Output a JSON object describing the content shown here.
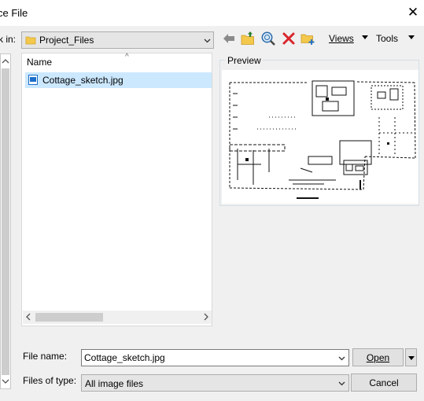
{
  "window": {
    "title": "ce File",
    "close_glyph": "✕"
  },
  "lookin": {
    "label": "k in:",
    "value": "Project_Files"
  },
  "toolbar": {
    "views_label": "Views",
    "tools_label": "Tools"
  },
  "filelist": {
    "header": "Name",
    "files": [
      {
        "name": "Cottage_sketch.jpg",
        "selected": true
      }
    ]
  },
  "preview": {
    "label": "Preview"
  },
  "filename": {
    "label": "File name:",
    "value": "Cottage_sketch.jpg"
  },
  "filetype": {
    "label": "Files of type:",
    "value": "All image files"
  },
  "buttons": {
    "open": "Open",
    "cancel": "Cancel"
  },
  "icons": {
    "back": "back-arrow-icon",
    "up": "up-folder-icon",
    "search": "search-web-icon",
    "delete": "delete-icon",
    "newfolder": "new-folder-icon"
  },
  "colors": {
    "selection": "#cce8ff",
    "folder": "#f3c84b",
    "delete": "#d9252b",
    "accent": "#1d6fc9"
  }
}
